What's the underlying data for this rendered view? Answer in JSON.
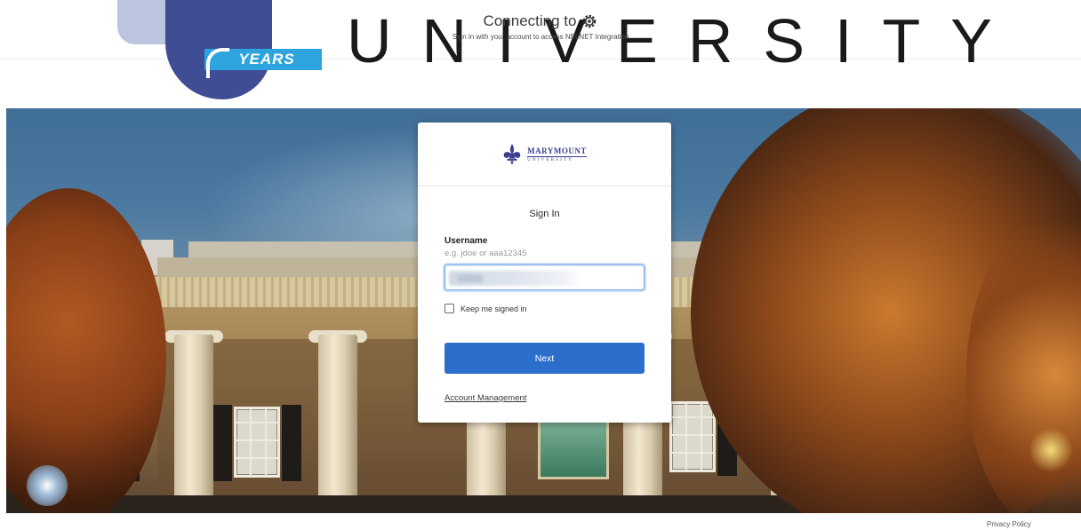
{
  "header": {
    "university_word": [
      "U",
      "N",
      "I",
      "V",
      "E",
      "R",
      "S",
      "I",
      "T",
      "Y"
    ],
    "logo_ribbon_text": "YEARS",
    "connecting_title": "Connecting to",
    "connecting_subtitle": "Sign in with your account to access NELNET Integration"
  },
  "card": {
    "brand_name": "MARYMOUNT",
    "brand_sub": "UNIVERSITY",
    "heading": "Sign In",
    "username_label": "Username",
    "username_hint": "e.g. jdoe or aaa12345",
    "username_value": "",
    "keep_signed_in_label": "Keep me signed in",
    "next_label": "Next",
    "account_management_label": "Account Management"
  },
  "footer": {
    "privacy_label": "Privacy Policy"
  },
  "colors": {
    "accent": "#2c6ecb",
    "brand": "#3a3f8f",
    "ribbon": "#2da4dd"
  }
}
